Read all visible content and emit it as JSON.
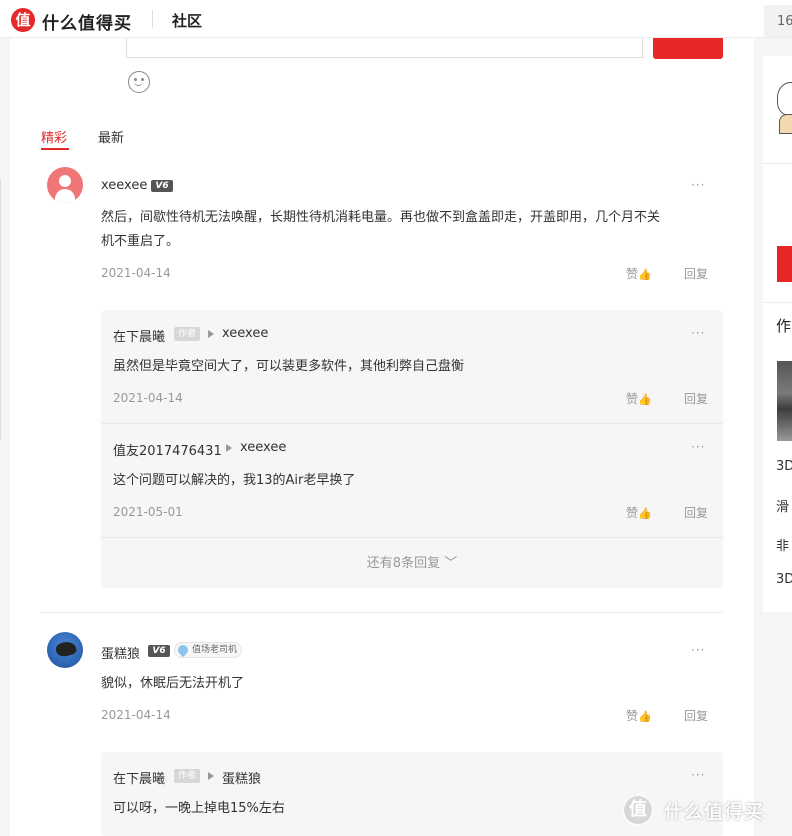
{
  "header": {
    "logo_glyph": "值",
    "logo_text": "什么值得买",
    "nav_community": "社区",
    "search_fragment": "16"
  },
  "tabs": [
    {
      "label": "精彩",
      "active": true
    },
    {
      "label": "最新",
      "active": false
    }
  ],
  "icons": {
    "more": "···",
    "thumb": "👍"
  },
  "actions": {
    "like": "赞",
    "reply": "回复"
  },
  "threads": [
    {
      "username": "xeexee",
      "level": "V6",
      "text_line1": "然后，间歇性待机无法唤醒，长期性待机消耗电量。再也做不到盒盖即走，开盖即用，几个月不关",
      "text_line2": "机不重启了。",
      "date": "2021-04-14",
      "replies": [
        {
          "username": "在下晨曦",
          "author_tag": "作者",
          "reply_to": "xeexee",
          "text": "虽然但是毕竟空间大了，可以装更多软件，其他利弊自己盘衡",
          "date": "2021-04-14"
        },
        {
          "username": "值友2017476431",
          "reply_to": "xeexee",
          "text": "这个问题可以解决的，我13的Air老早换了",
          "date": "2021-05-01"
        }
      ],
      "more_replies": "还有8条回复 ﹀"
    },
    {
      "username": "蛋糕狼",
      "level": "V6",
      "medal": "值场老司机",
      "text": "貌似，休眠后无法开机了",
      "date": "2021-04-14",
      "replies": [
        {
          "username": "在下晨曦",
          "author_tag": "作者",
          "reply_to": "蛋糕狼",
          "text": "可以呀，一晚上掉电15%左右"
        }
      ]
    }
  ],
  "sidebar": {
    "heading": "作",
    "items": [
      "3D",
      "滑",
      "非",
      "3D"
    ]
  },
  "watermark": {
    "glyph": "值",
    "text": "什么值得买"
  }
}
